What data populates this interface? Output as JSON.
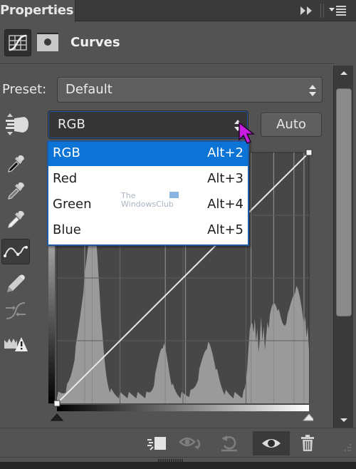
{
  "panel": {
    "tab_title": "Properties",
    "header_title": "Curves",
    "header_icons": [
      "curves-adjustment-icon",
      "layer-mask-icon"
    ],
    "titlebar_icons": [
      "collapse-icon",
      "panel-menu-icon"
    ]
  },
  "preset": {
    "label": "Preset:",
    "value": "Default"
  },
  "channel": {
    "value": "RGB",
    "auto_label": "Auto",
    "menu": [
      {
        "label": "RGB",
        "shortcut": "Alt+2",
        "selected": true
      },
      {
        "label": "Red",
        "shortcut": "Alt+3",
        "selected": false
      },
      {
        "label": "Green",
        "shortcut": "Alt+4",
        "selected": false
      },
      {
        "label": "Blue",
        "shortcut": "Alt+5",
        "selected": false
      }
    ],
    "selection_color": "#0c74d6"
  },
  "tools": [
    {
      "name": "on-image-adjust-tool",
      "icon": "hand-updown-icon"
    },
    {
      "name": "black-point-eyedropper",
      "icon": "eyedropper-black-icon"
    },
    {
      "name": "gray-point-eyedropper",
      "icon": "eyedropper-gray-icon"
    },
    {
      "name": "white-point-eyedropper",
      "icon": "eyedropper-white-icon"
    },
    {
      "name": "edit-points-tool",
      "icon": "curve-points-icon",
      "active": true
    },
    {
      "name": "draw-pencil-tool",
      "icon": "pencil-icon"
    },
    {
      "name": "smooth-curve-tool",
      "icon": "smooth-icon"
    },
    {
      "name": "clipping-warning",
      "icon": "crown-warning-icon"
    }
  ],
  "watermark": {
    "line1": "The",
    "line2": "WindowsClub"
  },
  "curve": {
    "points": [
      [
        0,
        0
      ],
      [
        255,
        255
      ]
    ],
    "input_range": [
      0,
      255
    ],
    "output_range": [
      0,
      255
    ]
  },
  "bottom_toolbar": [
    {
      "name": "clip-to-layer-button",
      "icon": "clip-layer-icon"
    },
    {
      "name": "view-previous-state-button",
      "icon": "eye-cycle-icon"
    },
    {
      "name": "reset-button",
      "icon": "reset-icon"
    },
    {
      "name": "toggle-visibility-button",
      "icon": "eye-icon",
      "active": true
    },
    {
      "name": "delete-adjustment-button",
      "icon": "trash-icon"
    }
  ]
}
